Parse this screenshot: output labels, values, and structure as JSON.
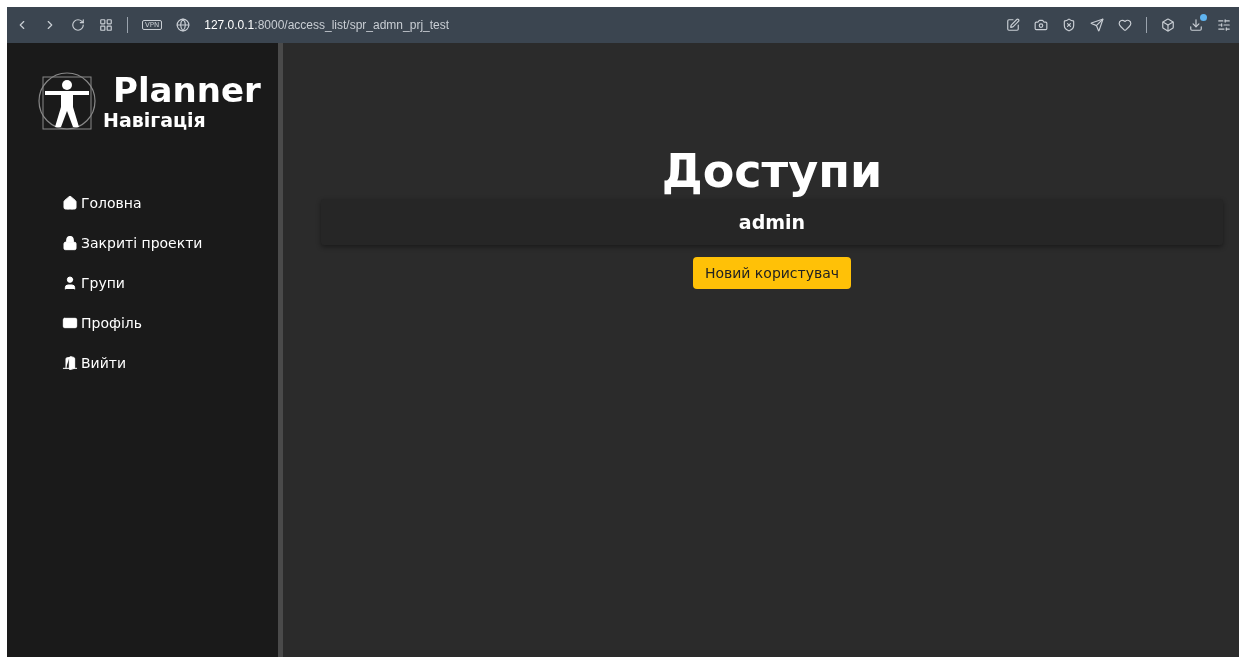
{
  "browser": {
    "vpn": "VPN",
    "url_host": "127.0.0.1",
    "url_path": ":8000/access_list/spr_admn_prj_test",
    "download_badge": true
  },
  "sidebar": {
    "brand": "Planner",
    "subtitle": "Навігація",
    "items": [
      {
        "label": "Головна"
      },
      {
        "label": "Закриті проекти"
      },
      {
        "label": "Групи"
      },
      {
        "label": "Профіль"
      },
      {
        "label": "Вийти"
      }
    ]
  },
  "main": {
    "title": "Доступи",
    "users": [
      "admin"
    ],
    "new_user_button": "Новий користувач"
  }
}
